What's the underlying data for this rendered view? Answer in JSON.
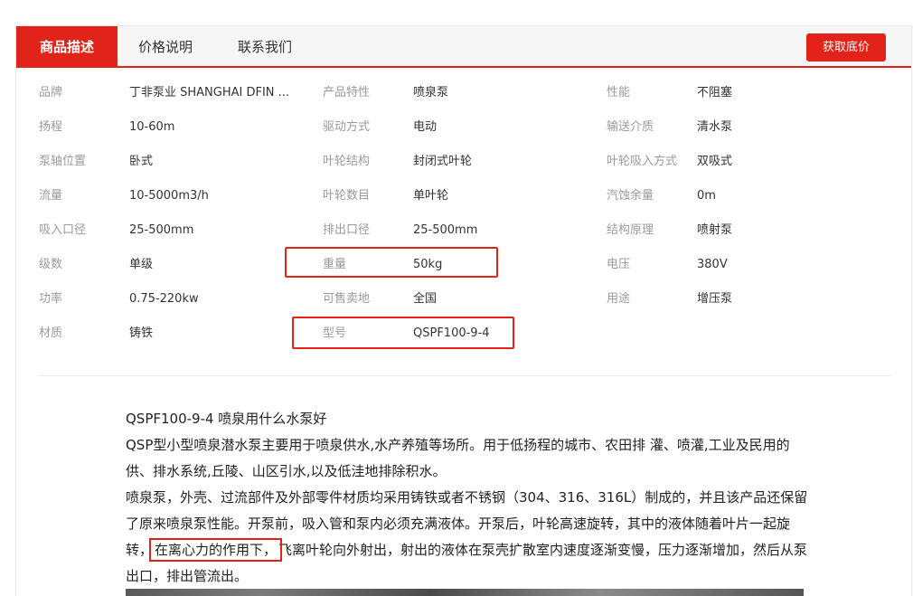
{
  "tabs": [
    {
      "label": "商品描述",
      "active": true
    },
    {
      "label": "价格说明",
      "active": false
    },
    {
      "label": "联系我们",
      "active": false
    }
  ],
  "cta_label": "获取底价",
  "specs": [
    [
      {
        "label": "品牌",
        "value": "丁非泵业 SHANGHAI DFIN ..."
      },
      {
        "label": "产品特性",
        "value": "喷泉泵"
      },
      {
        "label": "性能",
        "value": "不阻塞"
      }
    ],
    [
      {
        "label": "扬程",
        "value": "10-60m"
      },
      {
        "label": "驱动方式",
        "value": "电动"
      },
      {
        "label": "输送介质",
        "value": "清水泵"
      }
    ],
    [
      {
        "label": "泵轴位置",
        "value": "卧式"
      },
      {
        "label": "叶轮结构",
        "value": "封闭式叶轮"
      },
      {
        "label": "叶轮吸入方式",
        "value": "双吸式"
      }
    ],
    [
      {
        "label": "流量",
        "value": "10-5000m3/h"
      },
      {
        "label": "叶轮数目",
        "value": "单叶轮"
      },
      {
        "label": "汽蚀余量",
        "value": "0m"
      }
    ],
    [
      {
        "label": "吸入口径",
        "value": "25-500mm"
      },
      {
        "label": "排出口径",
        "value": "25-500mm"
      },
      {
        "label": "结构原理",
        "value": "喷射泵"
      }
    ],
    [
      {
        "label": "级数",
        "value": "单级"
      },
      {
        "label": "重量",
        "value": "50kg"
      },
      {
        "label": "电压",
        "value": "380V"
      }
    ],
    [
      {
        "label": "功率",
        "value": "0.75-220kw"
      },
      {
        "label": "可售卖地",
        "value": "全国"
      },
      {
        "label": "用途",
        "value": "增压泵"
      }
    ],
    [
      {
        "label": "材质",
        "value": "铸铁"
      },
      {
        "label": "型号",
        "value": "QSPF100-9-4"
      }
    ]
  ],
  "description": {
    "title": "QSPF100-9-4 喷泉用什么水泵好",
    "para1": "QSP型小型喷泉潜水泵主要用于喷泉供水,水产养殖等场所。用于低扬程的城市、农田排 灌、喷灌,工业及民用的供、排水系统,丘陵、山区引水,以及低洼地排除积水。",
    "para2_a": "喷泉泵，外壳、过流部件及外部零件材质均采用铸铁或者不锈钢（304、316、316L）制成的，并且该产品还保留了原来喷泉泵性能。开泵前，吸入管和泵内必须充满液体。开泵后，叶轮高速旋转，其中的液体随着叶片一起旋转，",
    "para2_highlight": "在离心力的作用下，",
    "para2_b": "飞离叶轮向外射出，射出的液体在泵壳扩散室内速度逐渐变慢，压力逐渐增加，然后从泵出口，排出管流出。"
  }
}
